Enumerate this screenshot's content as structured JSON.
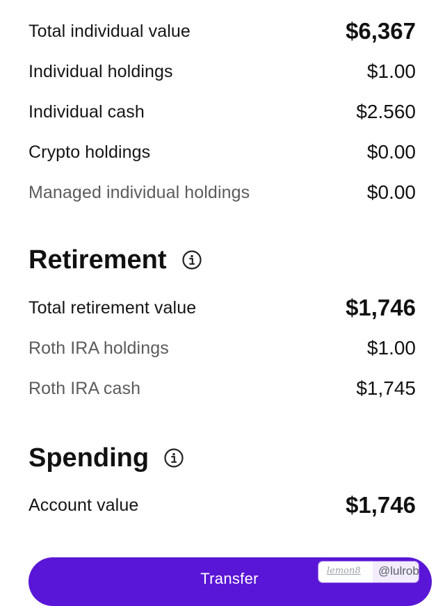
{
  "individual": {
    "rows": [
      {
        "label": "Total individual value",
        "value": "$6,367"
      },
      {
        "label": "Individual holdings",
        "value": "$1.00"
      },
      {
        "label": "Individual cash",
        "value": "$2.560"
      },
      {
        "label": "Crypto holdings",
        "value": "$0.00"
      },
      {
        "label": "Managed individual holdings",
        "value": "$0.00"
      }
    ]
  },
  "retirement": {
    "title": "Retirement",
    "info_icon": "info-circle-icon",
    "rows": [
      {
        "label": "Total retirement value",
        "value": "$1,746"
      },
      {
        "label": "Roth IRA holdings",
        "value": "$1.00"
      },
      {
        "label": "Roth IRA cash",
        "value": "$1,745"
      }
    ]
  },
  "spending": {
    "title": "Spending",
    "info_icon": "info-circle-icon",
    "rows": [
      {
        "label": "Account value",
        "value": "$1,746"
      }
    ]
  },
  "transfer_button": {
    "label": "Transfer"
  },
  "watermark": {
    "logo": "lemon8",
    "handle": "@lulrob"
  },
  "colors": {
    "accent": "#5a16d6",
    "text": "#111111",
    "muted": "#5b5b5b"
  }
}
